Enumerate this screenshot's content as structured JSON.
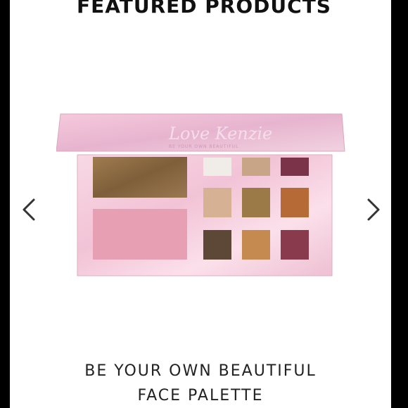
{
  "section": {
    "title": "FEATURED PRODUCTS"
  },
  "product": {
    "name_line_1": "BE YOUR OWN BEAUTIFUL",
    "name_line_2": "FACE PALETTE",
    "lid_script": "Love Kenzie",
    "lid_tagline": "BE YOUR OWN BEAUTIFUL"
  },
  "carousel": {
    "prev_icon": "chevron-left-icon",
    "next_icon": "chevron-right-icon"
  },
  "colors": {
    "background": "#000000",
    "panel": "#ffffff",
    "palette_pink": "#efc6d6",
    "bronzer": "#8d6e45",
    "blush": "#e7a0b3"
  }
}
